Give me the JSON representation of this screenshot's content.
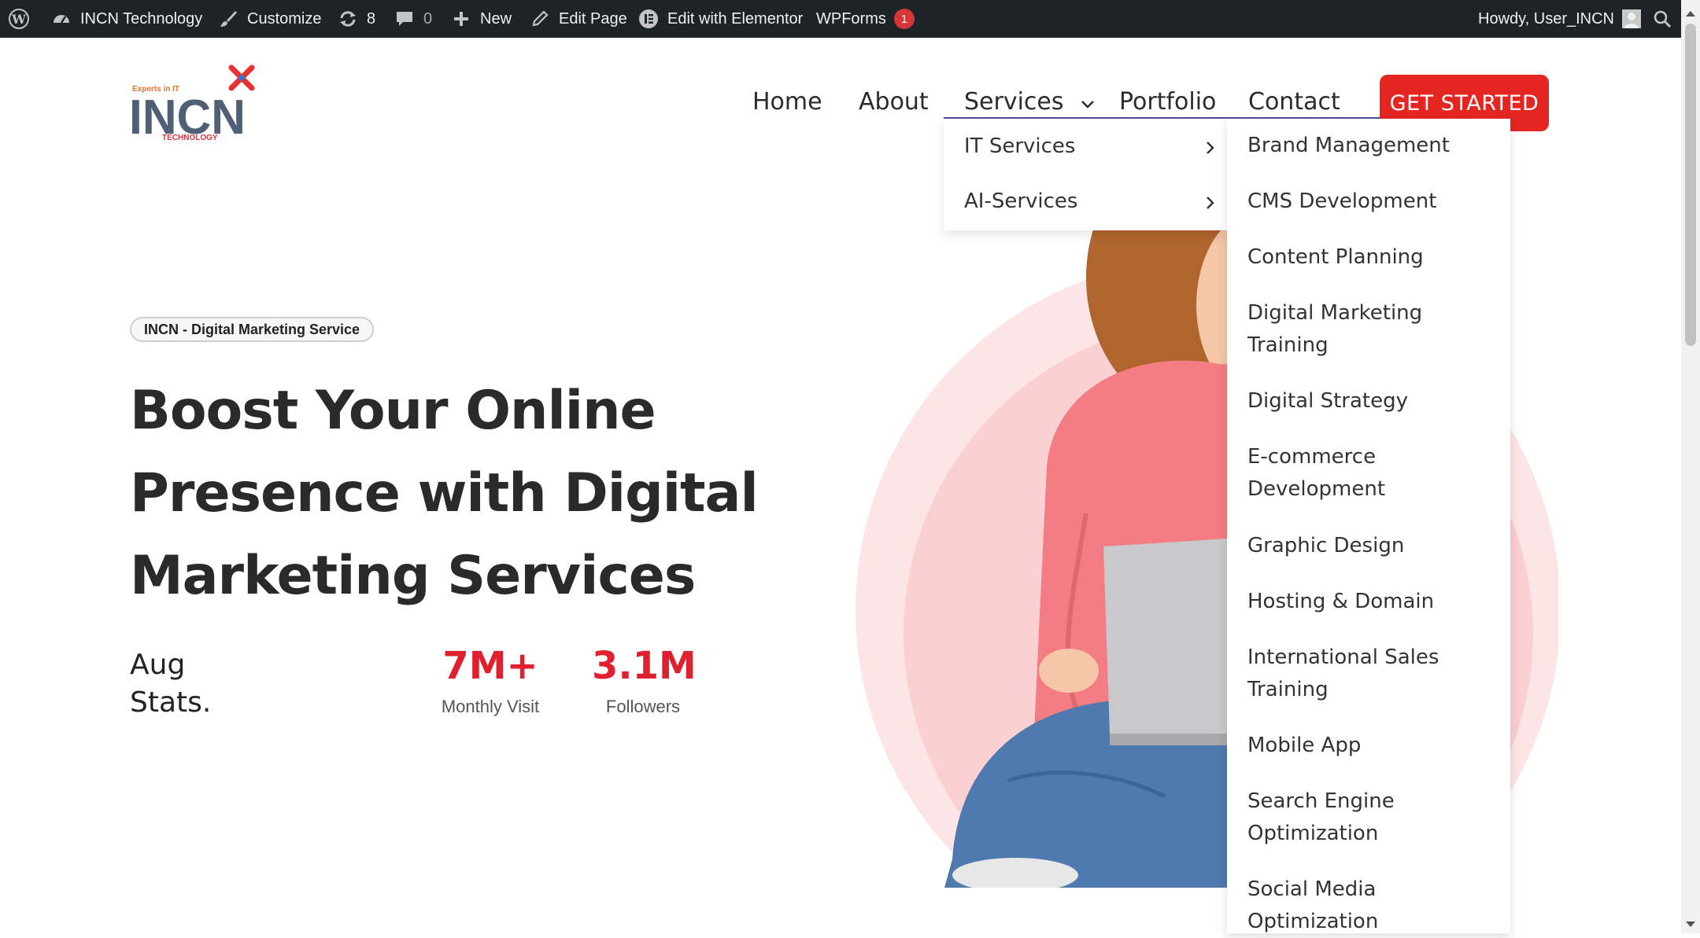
{
  "admin_bar": {
    "site_name": "INCN Technology",
    "customize": "Customize",
    "updates_count": "8",
    "comments_count": "0",
    "new": "New",
    "edit_page": "Edit Page",
    "edit_elementor": "Edit with Elementor",
    "wpforms": "WPForms",
    "wpforms_badge": "1",
    "greeting": "Howdy, User_INCN"
  },
  "logo": {
    "tagline": "Experts in IT",
    "wordmark": "INCN",
    "subtitle": "TECHNOLOGY"
  },
  "nav": {
    "items": [
      "Home",
      "About",
      "Services",
      "Portfolio",
      "Contact"
    ],
    "cta": "GET STARTED"
  },
  "services_menu": {
    "items": [
      "IT Services",
      "AI-Services"
    ]
  },
  "it_services_menu": {
    "items": [
      "Brand Management",
      "CMS Development",
      "Content Planning",
      "Digital Marketing Training",
      "Digital Strategy",
      "E-commerce Development",
      "Graphic Design",
      "Hosting & Domain",
      "International Sales Training",
      "Mobile App",
      "Search Engine Optimization",
      "Social Media Optimization"
    ]
  },
  "hero": {
    "pill": "INCN - Digital Marketing Service",
    "title_lines": [
      "Boost Your Online",
      "Presence with Digital",
      "Marketing Services"
    ],
    "stats_label_lines": [
      "Aug",
      "Stats."
    ],
    "stats": [
      {
        "value": "7M+",
        "label": "Monthly Visit"
      },
      {
        "value": "3.1M",
        "label": "Followers"
      }
    ]
  },
  "colors": {
    "admin_bar_bg": "#1d2327",
    "accent_red": "#e52521",
    "stat_red": "#e0202e",
    "nav_underline": "#4a4a9a",
    "circle_pink": "#fbdcdc"
  }
}
